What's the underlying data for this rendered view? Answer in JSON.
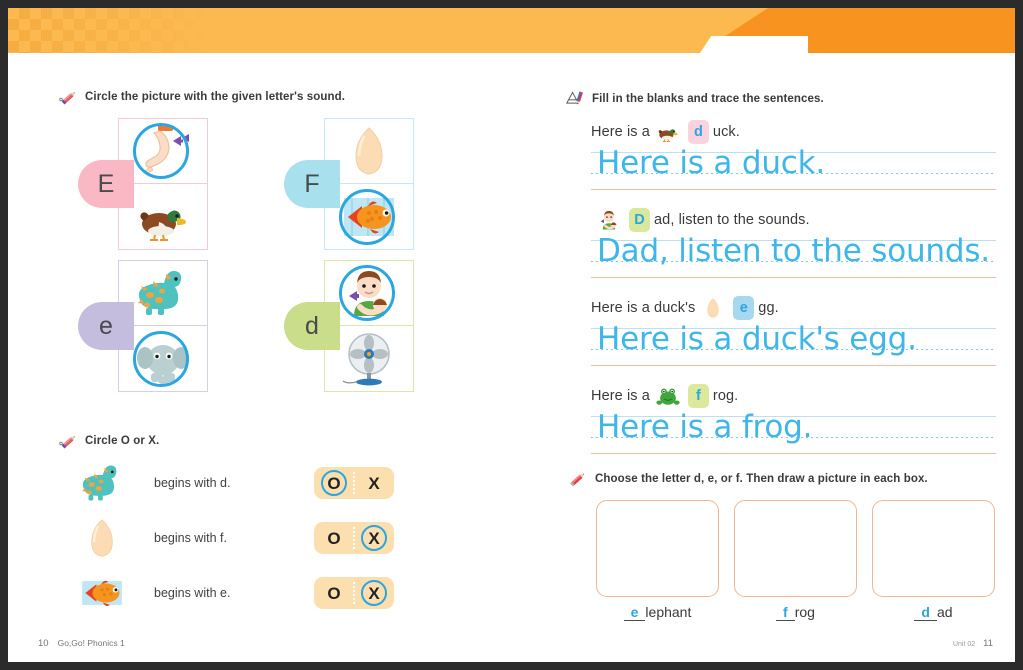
{
  "book": {
    "page_left": "10",
    "title": "Go,Go! Phonics 1",
    "page_right": "11",
    "footer_right_note": "Unit 02"
  },
  "colors": {
    "banner_dark": "#f7931e",
    "banner_light": "#fbb950",
    "trace_blue": "#3fb6ea",
    "circle_blue": "#2ba6e0",
    "pill_peach": "#fcdfae",
    "draw_box_border": "#f2b692"
  },
  "sections": {
    "letter_sound": {
      "icon": "pencil-icon",
      "instruction": "Circle the picture with the given letter's sound.",
      "groups": [
        {
          "letter": "E",
          "tab_color": "#f9b8c4",
          "box_border": "#f6c9d4",
          "items": [
            {
              "picture": "elbow-arm-image",
              "circled": true
            },
            {
              "picture": "duck-image",
              "circled": false
            }
          ]
        },
        {
          "letter": "F",
          "tab_color": "#a9e0ee",
          "box_border": "#c6e7f4",
          "items": [
            {
              "picture": "egg-image",
              "circled": false
            },
            {
              "picture": "fish-image",
              "circled": true
            }
          ]
        },
        {
          "letter": "e",
          "tab_color": "#c4bdde",
          "box_border": "#d4d0e8",
          "items": [
            {
              "picture": "dinosaur-image",
              "circled": false
            },
            {
              "picture": "elephant-image",
              "circled": true
            }
          ]
        },
        {
          "letter": "d",
          "tab_color": "#cadd8a",
          "box_border": "#d8e8ae",
          "items": [
            {
              "picture": "dad-and-baby-image",
              "circled": true
            },
            {
              "picture": "fan-image",
              "circled": false
            }
          ]
        }
      ]
    },
    "circle_o_or_x": {
      "icon": "pencil-icon",
      "instruction": "Circle O or X.",
      "option_o": "O",
      "option_x": "X",
      "rows": [
        {
          "picture": "dinosaur-image",
          "text": "begins with d.",
          "answer": "O"
        },
        {
          "picture": "egg-image",
          "text": "begins with f.",
          "answer": "X"
        },
        {
          "picture": "fish-image",
          "text": "begins with e.",
          "answer": "X"
        }
      ]
    },
    "fill_and_trace": {
      "icon": "pencil-and-paper-icon",
      "instruction": "Fill in the blanks and trace the sentences.",
      "items": [
        {
          "before": "Here is a",
          "picture": "duck-image",
          "blank_letter": "d",
          "blank_bg": "#fbd3de",
          "after": "uck.",
          "trace": "Here is a duck."
        },
        {
          "before": "",
          "picture": "dad-and-baby-image",
          "blank_letter": "D",
          "blank_bg": "#d9e89a",
          "after": "ad, listen to the sounds.",
          "trace": "Dad, listen to the sounds."
        },
        {
          "before": "Here is a duck's",
          "picture": "egg-image",
          "blank_letter": "e",
          "blank_bg": "#a8d8f0",
          "after": "gg.",
          "trace": "Here is a duck's egg."
        },
        {
          "before": "Here is a",
          "picture": "frog-image",
          "blank_letter": "f",
          "blank_bg": "#dce89a",
          "after": "rog.",
          "trace": "Here is a frog."
        }
      ]
    },
    "choose_and_draw": {
      "icon": "pencil-icon",
      "instruction": "Choose the letter d, e, or f. Then draw a picture in each box.",
      "boxes": [
        {
          "fill": "e",
          "rest": "lephant"
        },
        {
          "fill": "f",
          "rest": "rog"
        },
        {
          "fill": "d",
          "rest": "ad"
        }
      ]
    }
  }
}
